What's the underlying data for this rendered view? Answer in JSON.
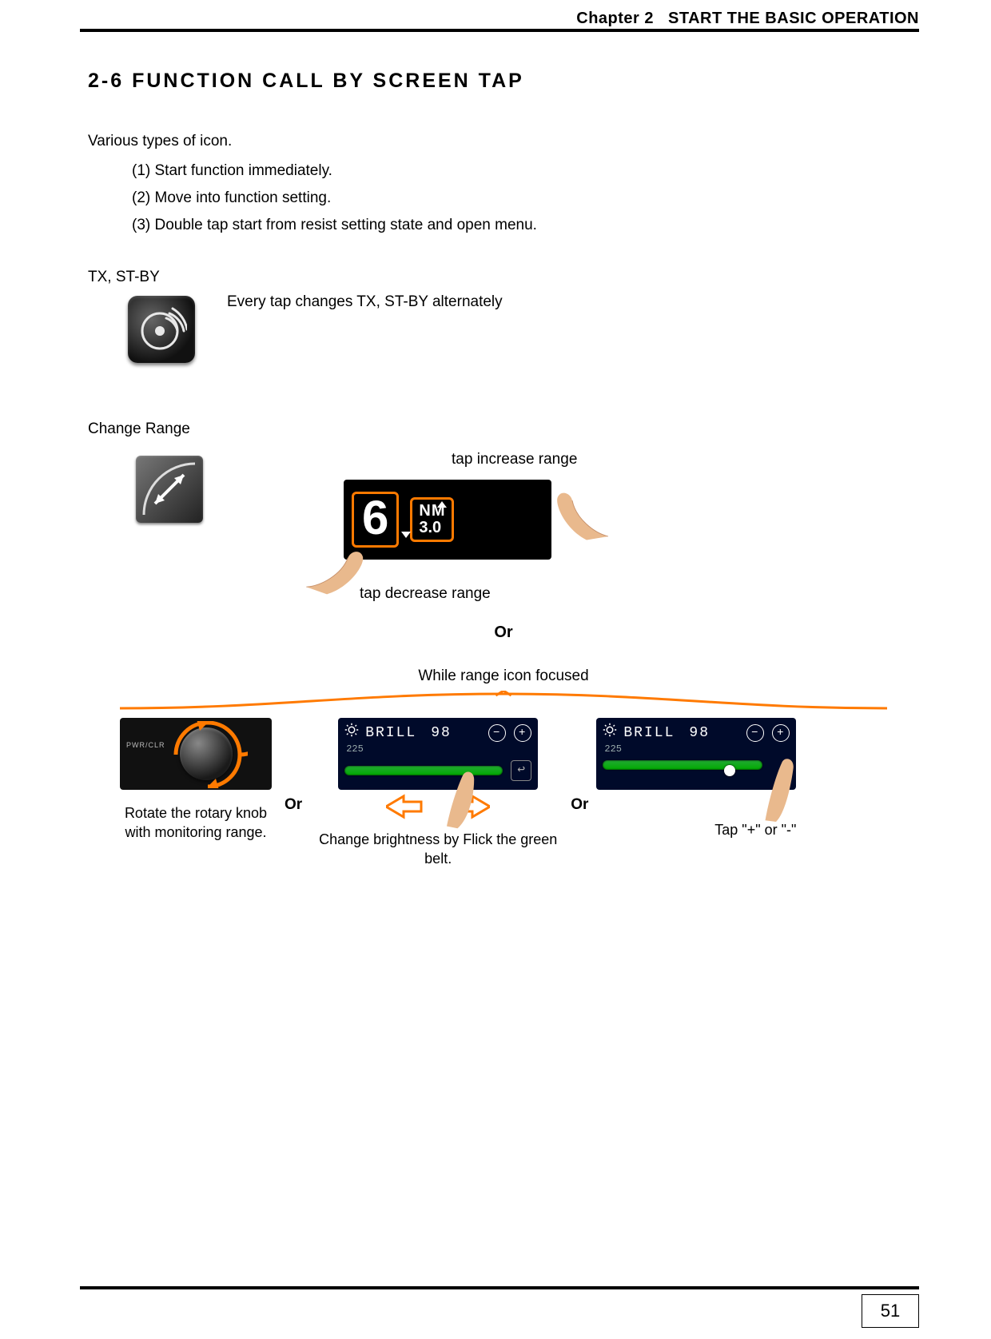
{
  "header": {
    "chapter_label": "Chapter 2",
    "chapter_title": "START THE BASIC OPERATION"
  },
  "section": {
    "title": "2-6 FUNCTION CALL BY SCREEN TAP",
    "intro": "Various types of icon.",
    "list": {
      "i1": "(1) Start function immediately.",
      "i2": "(2) Move into function setting.",
      "i3": "(3) Double tap start from resist setting state and open menu."
    }
  },
  "tx": {
    "label": "TX, ST-BY",
    "desc": "Every tap changes TX, ST-BY alternately"
  },
  "range": {
    "label": "Change Range",
    "tap_inc": "tap increase range",
    "tap_dec": "tap decrease range",
    "screen": {
      "value": "6",
      "unit": "NM",
      "sub": "3.0"
    }
  },
  "or": "Or",
  "while_focus": "While range icon focused",
  "knob": {
    "pwr": "PWR/CLR",
    "caption": "Rotate the rotary knob with monitoring range."
  },
  "brill": {
    "label": "BRILL",
    "value": "98",
    "sub": "225",
    "mid_caption": "Change brightness by Flick the green belt.",
    "pm_caption": "Tap \"+\" or \"-\""
  },
  "page_number": "51"
}
